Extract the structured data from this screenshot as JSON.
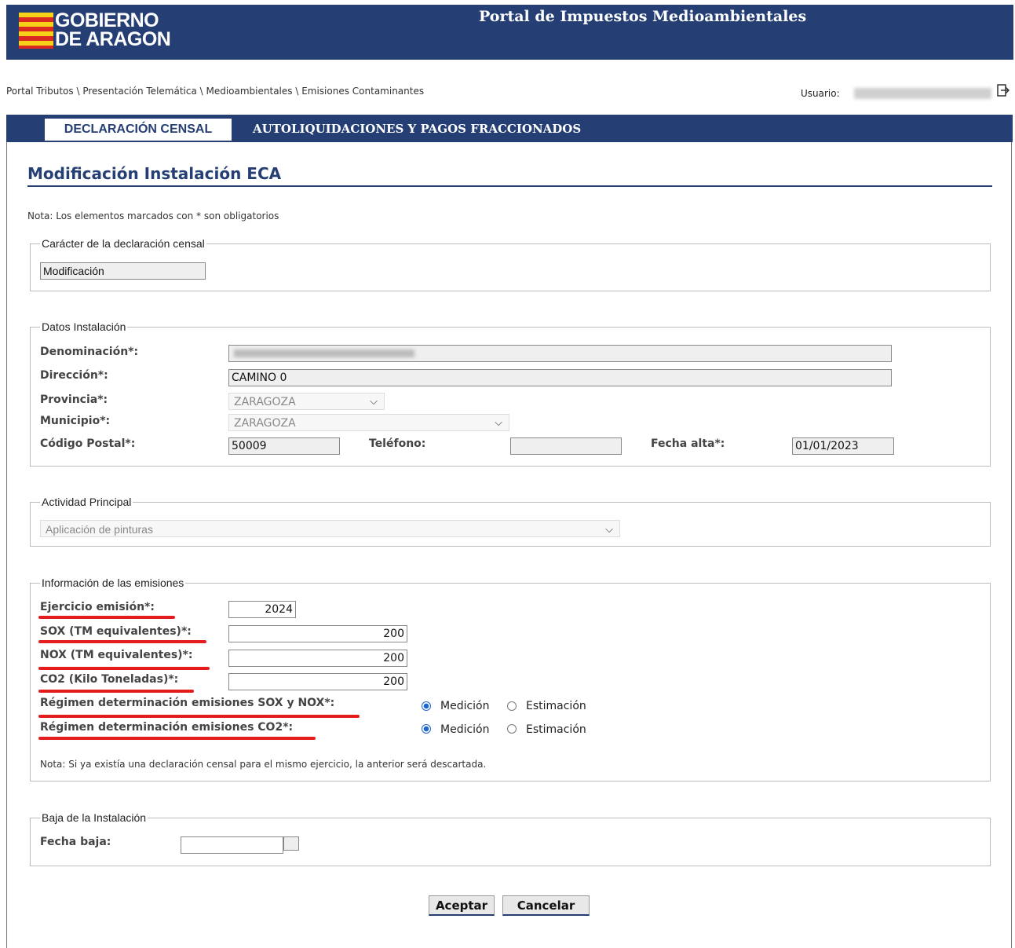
{
  "header": {
    "logo_line1": "GOBIERNO",
    "logo_line2": "DE ARAGON",
    "portal_title": "Portal de Impuestos Medioambientales"
  },
  "breadcrumb": "Portal Tributos \\ Presentación Telemática \\ Medioambientales \\ Emisiones Contaminantes",
  "user": {
    "label": "Usuario:"
  },
  "tabs": {
    "active": "DECLARACIÓN CENSAL",
    "inactive": "AUTOLIQUIDACIONES Y PAGOS FRACCIONADOS"
  },
  "page_title": "Modificación Instalación ECA",
  "note_required": "Nota: Los elementos marcados con * son obligatorios",
  "caracter": {
    "legend": "Carácter de la declaración censal",
    "value": "Modificación"
  },
  "instalacion": {
    "legend": "Datos Instalación",
    "denominacion_label": "Denominación*:",
    "direccion_label": "Dirección*:",
    "direccion_value": "CAMINO 0",
    "provincia_label": "Provincia*:",
    "provincia_value": "ZARAGOZA",
    "municipio_label": "Municipio*:",
    "municipio_value": "ZARAGOZA",
    "cp_label": "Código Postal*:",
    "cp_value": "50009",
    "telefono_label": "Teléfono:",
    "telefono_value": "",
    "fecha_alta_label": "Fecha alta*:",
    "fecha_alta_value": "01/01/2023"
  },
  "actividad": {
    "legend": "Actividad Principal",
    "value": "Aplicación de pinturas"
  },
  "emisiones": {
    "legend": "Información de las emisiones",
    "ejercicio_label": "Ejercicio emisión*:",
    "ejercicio_value": "2024",
    "sox_label": "SOX (TM equivalentes)*:",
    "sox_value": "200",
    "nox_label": "NOX (TM equivalentes)*:",
    "nox_value": "200",
    "co2_label": "CO2 (Kilo Toneladas)*:",
    "co2_value": "200",
    "regimen_soxnox_label": "Régimen determinación emisiones SOX y NOX*:",
    "regimen_co2_label": "Régimen determinación emisiones CO2*:",
    "opt_medicion": "Medición",
    "opt_estimacion": "Estimación",
    "note": "Nota: Si ya existía una declaración censal para el mismo ejercicio, la anterior será descartada."
  },
  "baja": {
    "legend": "Baja de la Instalación",
    "fecha_baja_label": "Fecha baja:",
    "fecha_baja_value": ""
  },
  "buttons": {
    "aceptar": "Aceptar",
    "cancelar": "Cancelar"
  },
  "colors": {
    "brand_blue": "#253f74",
    "highlight_red": "#e41c1c"
  }
}
